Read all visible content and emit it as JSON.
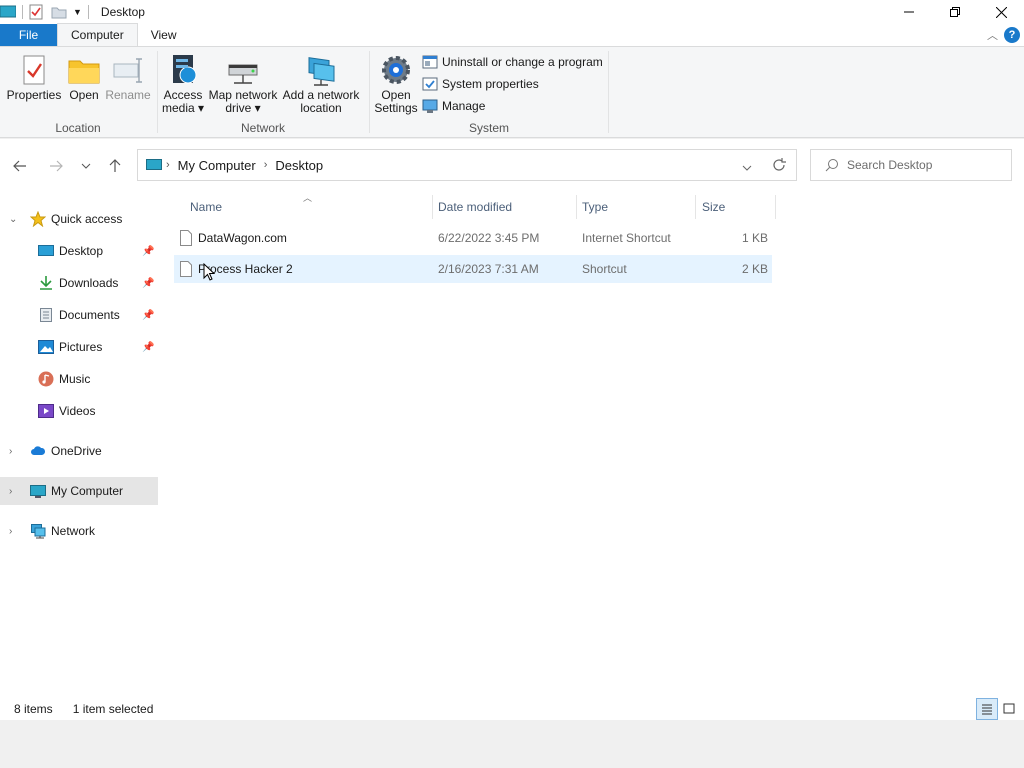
{
  "window": {
    "title": "Desktop"
  },
  "tabs": {
    "file": "File",
    "computer": "Computer",
    "view": "View"
  },
  "ribbon": {
    "location": {
      "label": "Location",
      "properties": "Properties",
      "open": "Open",
      "rename": "Rename"
    },
    "network": {
      "label": "Network",
      "access_media_1": "Access",
      "access_media_2": "media",
      "map_drive_1": "Map network",
      "map_drive_2": "drive",
      "add_location_1": "Add a network",
      "add_location_2": "location"
    },
    "system": {
      "label": "System",
      "open_settings_1": "Open",
      "open_settings_2": "Settings",
      "uninstall": "Uninstall or change a program",
      "system_properties": "System properties",
      "manage": "Manage"
    }
  },
  "address": {
    "crumbs": [
      "My Computer",
      "Desktop"
    ],
    "search_placeholder": "Search Desktop"
  },
  "sidebar": {
    "items": [
      {
        "label": "Quick access"
      },
      {
        "label": "Desktop"
      },
      {
        "label": "Downloads"
      },
      {
        "label": "Documents"
      },
      {
        "label": "Pictures"
      },
      {
        "label": "Music"
      },
      {
        "label": "Videos"
      },
      {
        "label": "OneDrive"
      },
      {
        "label": "My Computer"
      },
      {
        "label": "Network"
      }
    ]
  },
  "columns": {
    "name": "Name",
    "date": "Date modified",
    "type": "Type",
    "size": "Size"
  },
  "files": [
    {
      "name": "DataWagon.com",
      "date": "6/22/2022 3:45 PM",
      "type": "Internet Shortcut",
      "size": "1 KB"
    },
    {
      "name": "Process Hacker 2",
      "date": "2/16/2023 7:31 AM",
      "type": "Shortcut",
      "size": "2 KB"
    }
  ],
  "status": {
    "items": "8 items",
    "selected": "1 item selected"
  },
  "colors": {
    "accent": "#1979ca",
    "selection": "#e5f3ff"
  }
}
